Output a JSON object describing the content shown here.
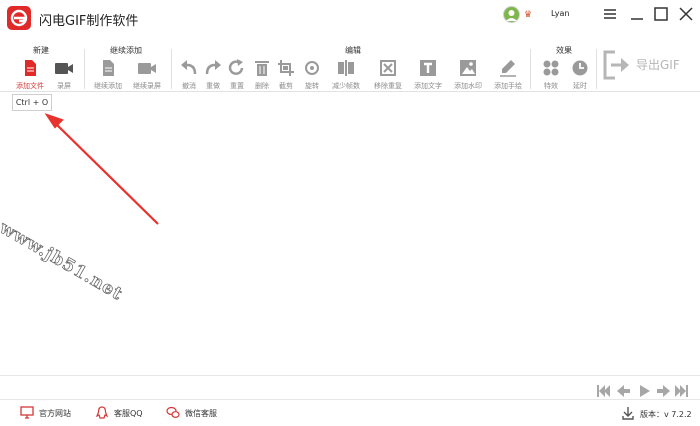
{
  "app": {
    "title": "闪电GIF制作软件"
  },
  "user": {
    "name": "Lyan",
    "avatar_icon": "avatar",
    "vip_icon": "crown-icon"
  },
  "window_controls": [
    "menu",
    "minimize",
    "maximize",
    "close"
  ],
  "ribbon": {
    "groups": {
      "new": "新建",
      "continue": "继续添加",
      "edit": "编辑",
      "effects": "效果"
    },
    "tools": {
      "add_file": "添加文件",
      "record": "录屏",
      "continue_add": "继续添加",
      "continue_record": "继续录屏",
      "undo": "撤消",
      "redo": "重做",
      "reset": "重置",
      "delete": "删除",
      "crop": "截剪",
      "rotate": "旋转",
      "reduce_frames": "减少帧数",
      "remove_duplicates": "移除重复",
      "add_text": "添加文字",
      "add_watermark": "添加水印",
      "add_handwriting": "添加手绘",
      "effects": "特效",
      "delay": "延时"
    },
    "export_label": "导出GIF"
  },
  "tooltip": "Ctrl + O",
  "watermark_text": "www.jb51.net",
  "colors": {
    "accent": "#e02a2a",
    "active_label": "#d43838",
    "disabled_icon": "#9a9a9a",
    "arrow": "#e8322d"
  },
  "playback": [
    "first-frame",
    "previous-frame",
    "play",
    "next-frame",
    "last-frame"
  ],
  "statusbar": {
    "website": "官方网站",
    "qq": "客服QQ",
    "wechat": "微信客服",
    "version": "版本：v 7.2.2"
  }
}
